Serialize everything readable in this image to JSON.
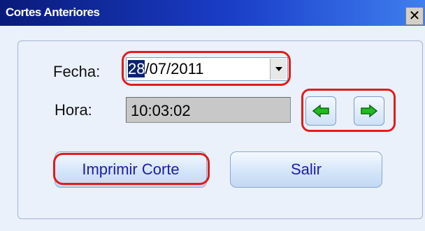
{
  "window": {
    "title": "Cortes Anteriores",
    "close_glyph": "✕"
  },
  "form": {
    "fecha_label": "Fecha:",
    "fecha_selected": "28",
    "fecha_rest": "/07/2011",
    "hora_label": "Hora:",
    "hora_value": "10:03:02"
  },
  "nav": {
    "prev_icon": "left-arrow-icon",
    "next_icon": "right-arrow-icon",
    "arrow_color": "#22bb22"
  },
  "buttons": {
    "print_label": "Imprimir Corte",
    "exit_label": "Salir"
  },
  "highlight_color": "#e31b1b"
}
